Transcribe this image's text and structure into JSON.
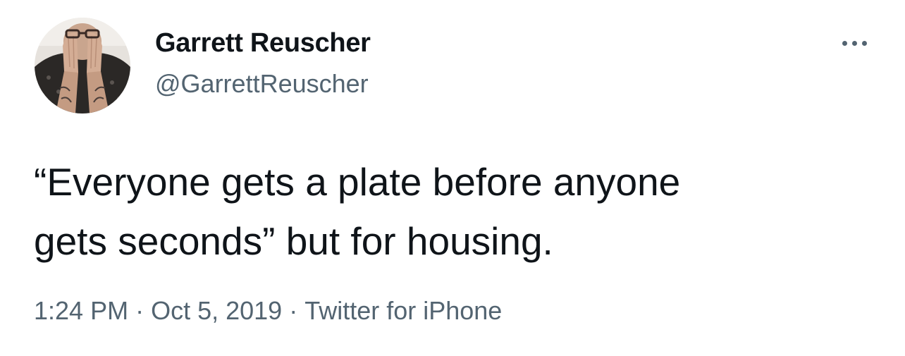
{
  "tweet": {
    "author": {
      "display_name": "Garrett Reuscher",
      "handle": "@GarrettReuscher"
    },
    "text_lines": [
      "“Everyone gets a plate before anyone",
      "gets seconds” but for housing."
    ],
    "meta": {
      "time": "1:24 PM",
      "separator": "·",
      "date": "Oct 5, 2019",
      "source": "Twitter for iPhone"
    },
    "more_icon": "ellipsis-icon"
  },
  "colors": {
    "text_primary": "#0f1419",
    "text_secondary": "#536471",
    "background": "#ffffff"
  }
}
